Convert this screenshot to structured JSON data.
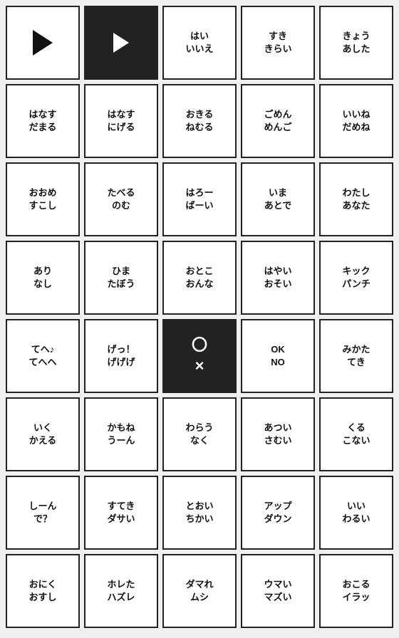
{
  "grid": {
    "rows": [
      [
        {
          "type": "play-outline",
          "text": "",
          "dark": false
        },
        {
          "type": "play-dark",
          "text": "",
          "dark": true
        },
        {
          "type": "text",
          "text": "はい\nいいえ",
          "dark": false
        },
        {
          "type": "text",
          "text": "すき\nきらい",
          "dark": false
        },
        {
          "type": "text",
          "text": "きょう\nあした",
          "dark": false
        }
      ],
      [
        {
          "type": "text",
          "text": "はなす\nだまる",
          "dark": false
        },
        {
          "type": "text",
          "text": "はなす\nにげる",
          "dark": false
        },
        {
          "type": "text",
          "text": "おきる\nねむる",
          "dark": false
        },
        {
          "type": "text",
          "text": "ごめん\nめんご",
          "dark": false
        },
        {
          "type": "text",
          "text": "いいね\nだめね",
          "dark": false
        }
      ],
      [
        {
          "type": "text",
          "text": "おおめ\nすこし",
          "dark": false
        },
        {
          "type": "text",
          "text": "たべる\nのむ",
          "dark": false
        },
        {
          "type": "text",
          "text": "はろー\nばーい",
          "dark": false
        },
        {
          "type": "text",
          "text": "いま\nあとで",
          "dark": false
        },
        {
          "type": "text",
          "text": "わたし\nあなた",
          "dark": false
        }
      ],
      [
        {
          "type": "text",
          "text": "あり\nなし",
          "dark": false
        },
        {
          "type": "text",
          "text": "ひま\nたぼう",
          "dark": false
        },
        {
          "type": "text",
          "text": "おとこ\nおんな",
          "dark": false
        },
        {
          "type": "text",
          "text": "はやい\nおそい",
          "dark": false
        },
        {
          "type": "text",
          "text": "キック\nパンチ",
          "dark": false
        }
      ],
      [
        {
          "type": "text",
          "text": "てへ♪\nてへヘ",
          "dark": false
        },
        {
          "type": "text",
          "text": "げっ！\nげげげ",
          "dark": false
        },
        {
          "type": "circle-x",
          "text": "〇\n×",
          "dark": true
        },
        {
          "type": "text",
          "text": "OK\nNO",
          "dark": false
        },
        {
          "type": "text",
          "text": "みかた\nてき",
          "dark": false
        }
      ],
      [
        {
          "type": "text",
          "text": "いく\nかえる",
          "dark": false
        },
        {
          "type": "text",
          "text": "かもね\nうーん",
          "dark": false
        },
        {
          "type": "text",
          "text": "わらう\nなく",
          "dark": false
        },
        {
          "type": "text",
          "text": "あつい\nさむい",
          "dark": false
        },
        {
          "type": "text",
          "text": "くる\nこない",
          "dark": false
        }
      ],
      [
        {
          "type": "text",
          "text": "しーん\nで？",
          "dark": false
        },
        {
          "type": "text",
          "text": "すてき\nダサい",
          "dark": false
        },
        {
          "type": "text",
          "text": "とおい\nちかい",
          "dark": false
        },
        {
          "type": "text",
          "text": "アップ\nダウン",
          "dark": false
        },
        {
          "type": "text",
          "text": "いい\nわるい",
          "dark": false
        }
      ],
      [
        {
          "type": "text",
          "text": "おにく\nおすし",
          "dark": false
        },
        {
          "type": "text",
          "text": "ホレた\nハズレ",
          "dark": false
        },
        {
          "type": "text",
          "text": "ダマれ\nムシ",
          "dark": false
        },
        {
          "type": "text",
          "text": "ウマい\nマズい",
          "dark": false
        },
        {
          "type": "text",
          "text": "おこる\nイラッ",
          "dark": false
        }
      ]
    ]
  }
}
